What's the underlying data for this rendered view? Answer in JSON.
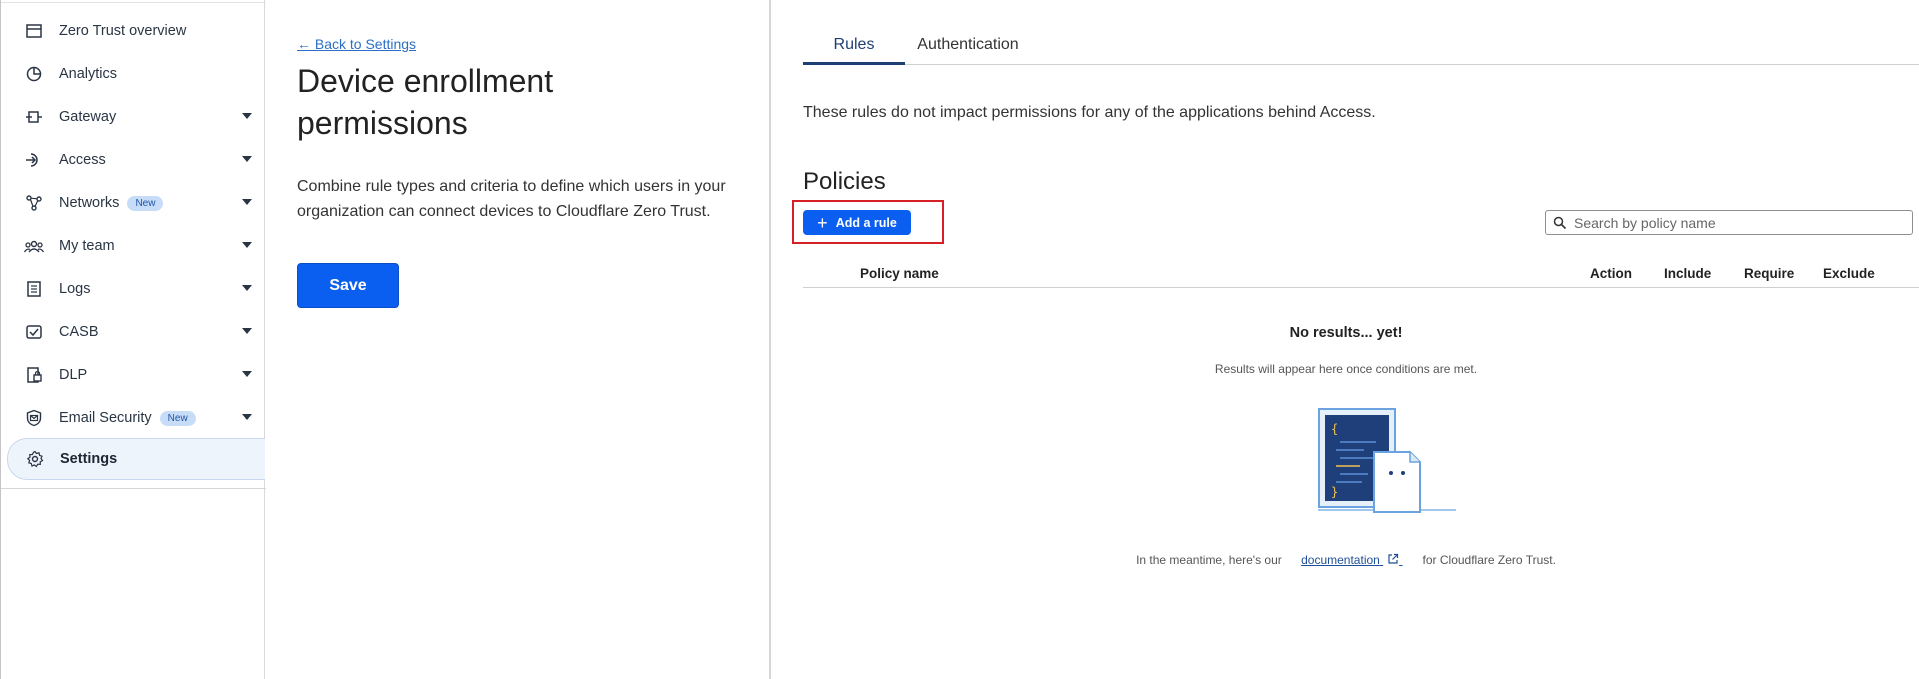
{
  "sidebar": {
    "items": [
      {
        "label": "Zero Trust overview",
        "icon": "browser-window-icon",
        "has_caret": false
      },
      {
        "label": "Analytics",
        "icon": "pie-chart-icon",
        "has_caret": false
      },
      {
        "label": "Gateway",
        "icon": "gateway-icon",
        "has_caret": true
      },
      {
        "label": "Access",
        "icon": "access-icon",
        "has_caret": true
      },
      {
        "label": "Networks",
        "badge": "New",
        "icon": "network-icon",
        "has_caret": true
      },
      {
        "label": "My team",
        "icon": "team-icon",
        "has_caret": true
      },
      {
        "label": "Logs",
        "icon": "logs-icon",
        "has_caret": true
      },
      {
        "label": "CASB",
        "icon": "casb-icon",
        "has_caret": true
      },
      {
        "label": "DLP",
        "icon": "dlp-icon",
        "has_caret": true
      },
      {
        "label": "Email Security",
        "badge": "New",
        "icon": "email-security-icon",
        "has_caret": true
      },
      {
        "label": "Settings",
        "icon": "gear-icon",
        "has_caret": false,
        "active": true
      }
    ]
  },
  "middle": {
    "back_link": "← Back to Settings",
    "title": "Device enrollment permissions",
    "description": "Combine rule types and criteria to define which users in your organization can connect devices to Cloudflare Zero Trust.",
    "save_label": "Save"
  },
  "right": {
    "tabs": [
      {
        "label": "Rules",
        "active": true
      },
      {
        "label": "Authentication",
        "active": false
      }
    ],
    "info_text": "These rules do not impact permissions for any of the applications behind Access.",
    "policies_heading": "Policies",
    "add_rule_label": "Add a rule",
    "search_placeholder": "Search by policy name",
    "table_columns": [
      "Policy name",
      "Action",
      "Include",
      "Require",
      "Exclude"
    ],
    "empty_title": "No results... yet!",
    "empty_subtitle": "Results will appear here once conditions are met.",
    "footer_before": "In the meantime, here's our",
    "footer_link": "documentation",
    "footer_after": "for Cloudflare Zero Trust."
  },
  "colors": {
    "accent": "#0a5ff0",
    "highlight": "#d61f26",
    "tab_active": "#1e3f73"
  }
}
